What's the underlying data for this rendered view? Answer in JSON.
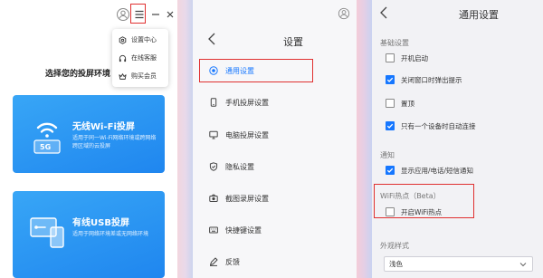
{
  "main_window": {
    "dropdown_menu": [
      {
        "label": "设置中心",
        "icon": "gear-icon"
      },
      {
        "label": "在线客服",
        "icon": "headset-icon"
      },
      {
        "label": "购买会员",
        "icon": "crown-icon"
      }
    ],
    "heading": "选择您的投屏环境",
    "cards": [
      {
        "icon_badge": "5G",
        "title": "无线Wi-Fi投屏",
        "desc": "适用于同一Wi-Fi网络环境或跨网络跨区域的云投屏"
      },
      {
        "title": "有线USB投屏",
        "desc": "适用于网络环境差或无网络环境"
      }
    ]
  },
  "settings_nav": {
    "title": "设置",
    "items": [
      {
        "label": "通用设置",
        "icon": "target-icon",
        "active": true
      },
      {
        "label": "手机投屏设置",
        "icon": "phone-icon",
        "active": false
      },
      {
        "label": "电脑投屏设置",
        "icon": "monitor-icon",
        "active": false
      },
      {
        "label": "隐私设置",
        "icon": "shield-icon",
        "active": false
      },
      {
        "label": "截图录屏设置",
        "icon": "camera-icon",
        "active": false
      },
      {
        "label": "快捷键设置",
        "icon": "keyboard-icon",
        "active": false
      },
      {
        "label": "反馈",
        "icon": "pen-icon",
        "active": false
      }
    ]
  },
  "general_settings": {
    "title": "通用设置",
    "sections": {
      "basic": "基础设置",
      "notify": "通知",
      "wifi_hotspot": "WiFi热点（Beta）",
      "appearance": "外观样式"
    },
    "options": {
      "autostart": {
        "label": "开机启动",
        "checked": false
      },
      "close_popup": {
        "label": "关闭窗口时弹出提示",
        "checked": true
      },
      "pin_top": {
        "label": "置顶",
        "checked": false
      },
      "single_device": {
        "label": "只有一个设备时自动连接",
        "checked": true
      },
      "show_notify": {
        "label": "显示应用/电话/短信通知",
        "checked": true
      },
      "enable_hotspot": {
        "label": "开启WiFi热点",
        "checked": false
      }
    },
    "theme_select": "浅色"
  },
  "colors": {
    "accent": "#1677ff",
    "highlight_box": "#e03030",
    "card_blue": "#2a92f2"
  }
}
